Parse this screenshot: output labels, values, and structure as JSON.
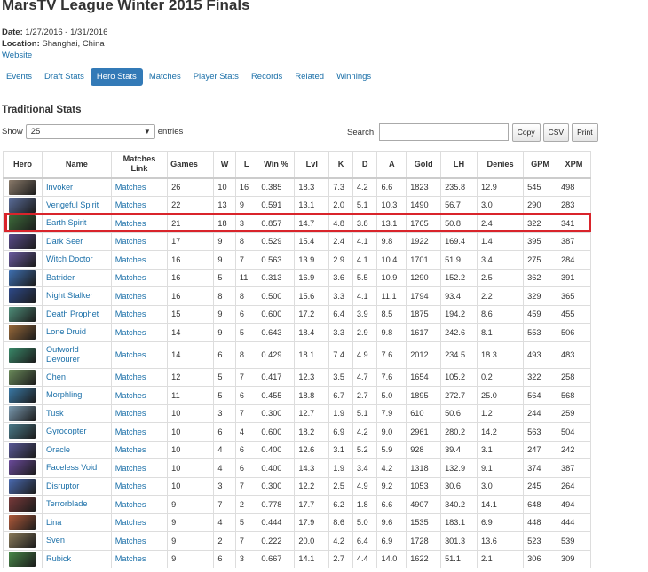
{
  "page": {
    "title": "MarsTV League Winter 2015 Finals",
    "date_label": "Date:",
    "date_value": "1/27/2016 - 1/31/2016",
    "location_label": "Location:",
    "location_value": "Shanghai, China",
    "website_link": "Website"
  },
  "tabs": [
    "Events",
    "Draft Stats",
    "Hero Stats",
    "Matches",
    "Player Stats",
    "Records",
    "Related",
    "Winnings"
  ],
  "active_tab": "Hero Stats",
  "section_title": "Traditional Stats",
  "controls": {
    "show_label": "Show",
    "entries_value": "25",
    "entries_label": "entries",
    "search_label": "Search:",
    "search_value": "",
    "copy_label": "Copy",
    "csv_label": "CSV",
    "print_label": "Print"
  },
  "colors": {
    "link": "#1a6fa8",
    "active_tab": "#337ab7",
    "highlight": "#d9242b"
  },
  "table": {
    "headers": [
      "Hero",
      "Name",
      "Matches Link",
      "Games",
      "W",
      "L",
      "Win %",
      "Lvl",
      "K",
      "D",
      "A",
      "Gold",
      "LH",
      "Denies",
      "GPM",
      "XPM"
    ],
    "link_text": "Matches",
    "highlighted_hero": "Earth Spirit",
    "rows": [
      {
        "name": "Invoker",
        "color": "#8a7a6a",
        "games": "26",
        "w": "10",
        "l": "16",
        "win": "0.385",
        "lvl": "18.3",
        "k": "7.3",
        "d": "4.2",
        "a": "6.6",
        "gold": "1823",
        "lh": "235.8",
        "denies": "12.9",
        "gpm": "545",
        "xpm": "498"
      },
      {
        "name": "Vengeful Spirit",
        "color": "#5a6d9a",
        "games": "22",
        "w": "13",
        "l": "9",
        "win": "0.591",
        "lvl": "13.1",
        "k": "2.0",
        "d": "5.1",
        "a": "10.3",
        "gold": "1490",
        "lh": "56.7",
        "denies": "3.0",
        "gpm": "290",
        "xpm": "283"
      },
      {
        "name": "Earth Spirit",
        "color": "#3d6b3a",
        "games": "21",
        "w": "18",
        "l": "3",
        "win": "0.857",
        "lvl": "14.7",
        "k": "4.8",
        "d": "3.8",
        "a": "13.1",
        "gold": "1765",
        "lh": "50.8",
        "denies": "2.4",
        "gpm": "322",
        "xpm": "341"
      },
      {
        "name": "Dark Seer",
        "color": "#5a4b8c",
        "games": "17",
        "w": "9",
        "l": "8",
        "win": "0.529",
        "lvl": "15.4",
        "k": "2.4",
        "d": "4.1",
        "a": "9.8",
        "gold": "1922",
        "lh": "169.4",
        "denies": "1.4",
        "gpm": "395",
        "xpm": "387"
      },
      {
        "name": "Witch Doctor",
        "color": "#6a5aa0",
        "games": "16",
        "w": "9",
        "l": "7",
        "win": "0.563",
        "lvl": "13.9",
        "k": "2.9",
        "d": "4.1",
        "a": "10.4",
        "gold": "1701",
        "lh": "51.9",
        "denies": "3.4",
        "gpm": "275",
        "xpm": "284"
      },
      {
        "name": "Batrider",
        "color": "#3e6fb0",
        "games": "16",
        "w": "5",
        "l": "11",
        "win": "0.313",
        "lvl": "16.9",
        "k": "3.6",
        "d": "5.5",
        "a": "10.9",
        "gold": "1290",
        "lh": "152.2",
        "denies": "2.5",
        "gpm": "362",
        "xpm": "391"
      },
      {
        "name": "Night Stalker",
        "color": "#2e4a8a",
        "games": "16",
        "w": "8",
        "l": "8",
        "win": "0.500",
        "lvl": "15.6",
        "k": "3.3",
        "d": "4.1",
        "a": "11.1",
        "gold": "1794",
        "lh": "93.4",
        "denies": "2.2",
        "gpm": "329",
        "xpm": "365"
      },
      {
        "name": "Death Prophet",
        "color": "#4f8f7a",
        "games": "15",
        "w": "9",
        "l": "6",
        "win": "0.600",
        "lvl": "17.2",
        "k": "6.4",
        "d": "3.9",
        "a": "8.5",
        "gold": "1875",
        "lh": "194.2",
        "denies": "8.6",
        "gpm": "459",
        "xpm": "455"
      },
      {
        "name": "Lone Druid",
        "color": "#9a6a3a",
        "games": "14",
        "w": "9",
        "l": "5",
        "win": "0.643",
        "lvl": "18.4",
        "k": "3.3",
        "d": "2.9",
        "a": "9.8",
        "gold": "1617",
        "lh": "242.6",
        "denies": "8.1",
        "gpm": "553",
        "xpm": "506"
      },
      {
        "name": "Outworld Devourer",
        "color": "#3a8a6a",
        "games": "14",
        "w": "6",
        "l": "8",
        "win": "0.429",
        "lvl": "18.1",
        "k": "7.4",
        "d": "4.9",
        "a": "7.6",
        "gold": "2012",
        "lh": "234.5",
        "denies": "18.3",
        "gpm": "493",
        "xpm": "483"
      },
      {
        "name": "Chen",
        "color": "#6a8a5a",
        "games": "12",
        "w": "5",
        "l": "7",
        "win": "0.417",
        "lvl": "12.3",
        "k": "3.5",
        "d": "4.7",
        "a": "7.6",
        "gold": "1654",
        "lh": "105.2",
        "denies": "0.2",
        "gpm": "322",
        "xpm": "258"
      },
      {
        "name": "Morphling",
        "color": "#3a7aa8",
        "games": "11",
        "w": "5",
        "l": "6",
        "win": "0.455",
        "lvl": "18.8",
        "k": "6.7",
        "d": "2.7",
        "a": "5.0",
        "gold": "1895",
        "lh": "272.7",
        "denies": "25.0",
        "gpm": "564",
        "xpm": "568"
      },
      {
        "name": "Tusk",
        "color": "#7a9ab0",
        "games": "10",
        "w": "3",
        "l": "7",
        "win": "0.300",
        "lvl": "12.7",
        "k": "1.9",
        "d": "5.1",
        "a": "7.9",
        "gold": "610",
        "lh": "50.6",
        "denies": "1.2",
        "gpm": "244",
        "xpm": "259"
      },
      {
        "name": "Gyrocopter",
        "color": "#4a7a8a",
        "games": "10",
        "w": "6",
        "l": "4",
        "win": "0.600",
        "lvl": "18.2",
        "k": "6.9",
        "d": "4.2",
        "a": "9.0",
        "gold": "2961",
        "lh": "280.2",
        "denies": "14.2",
        "gpm": "563",
        "xpm": "504"
      },
      {
        "name": "Oracle",
        "color": "#5a5a9a",
        "games": "10",
        "w": "4",
        "l": "6",
        "win": "0.400",
        "lvl": "12.6",
        "k": "3.1",
        "d": "5.2",
        "a": "5.9",
        "gold": "928",
        "lh": "39.4",
        "denies": "3.1",
        "gpm": "247",
        "xpm": "242"
      },
      {
        "name": "Faceless Void",
        "color": "#6a4a9a",
        "games": "10",
        "w": "4",
        "l": "6",
        "win": "0.400",
        "lvl": "14.3",
        "k": "1.9",
        "d": "3.4",
        "a": "4.2",
        "gold": "1318",
        "lh": "132.9",
        "denies": "9.1",
        "gpm": "374",
        "xpm": "387"
      },
      {
        "name": "Disruptor",
        "color": "#4a6ab0",
        "games": "10",
        "w": "3",
        "l": "7",
        "win": "0.300",
        "lvl": "12.2",
        "k": "2.5",
        "d": "4.9",
        "a": "9.2",
        "gold": "1053",
        "lh": "30.6",
        "denies": "3.0",
        "gpm": "245",
        "xpm": "264"
      },
      {
        "name": "Terrorblade",
        "color": "#7a3a3a",
        "games": "9",
        "w": "7",
        "l": "2",
        "win": "0.778",
        "lvl": "17.7",
        "k": "6.2",
        "d": "1.8",
        "a": "6.6",
        "gold": "4907",
        "lh": "340.2",
        "denies": "14.1",
        "gpm": "648",
        "xpm": "494"
      },
      {
        "name": "Lina",
        "color": "#b05a3a",
        "games": "9",
        "w": "4",
        "l": "5",
        "win": "0.444",
        "lvl": "17.9",
        "k": "8.6",
        "d": "5.0",
        "a": "9.6",
        "gold": "1535",
        "lh": "183.1",
        "denies": "6.9",
        "gpm": "448",
        "xpm": "444"
      },
      {
        "name": "Sven",
        "color": "#8a7a5a",
        "games": "9",
        "w": "2",
        "l": "7",
        "win": "0.222",
        "lvl": "20.0",
        "k": "4.2",
        "d": "6.4",
        "a": "6.9",
        "gold": "1728",
        "lh": "301.3",
        "denies": "13.6",
        "gpm": "523",
        "xpm": "539"
      },
      {
        "name": "Rubick",
        "color": "#4a8a4a",
        "games": "9",
        "w": "6",
        "l": "3",
        "win": "0.667",
        "lvl": "14.1",
        "k": "2.7",
        "d": "4.4",
        "a": "14.0",
        "gold": "1622",
        "lh": "51.1",
        "denies": "2.1",
        "gpm": "306",
        "xpm": "309"
      }
    ]
  }
}
